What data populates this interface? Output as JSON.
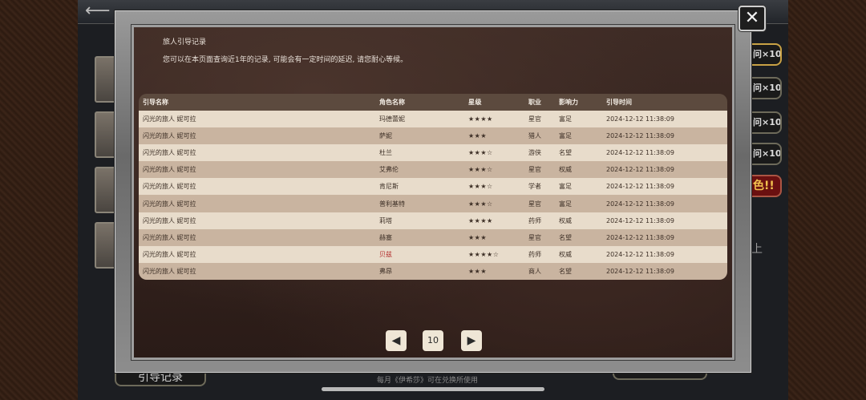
{
  "background": {
    "side_buttons": [
      "问×10",
      "问×10",
      "问×10",
      "问×10",
      "色!!"
    ],
    "side_text": "上",
    "bottom_button_label": "引导记录",
    "bottom_text": "每月《伊希莎》可在兑换所使用"
  },
  "modal": {
    "close_label": "✕",
    "title": "旅人引导记录",
    "subtitle": "您可以在本页面查询近1年的记录, 可能会有一定时间的延迟, 请您耐心等候。"
  },
  "table": {
    "headers": [
      "引导名称",
      "角色名称",
      "星级",
      "职业",
      "影响力",
      "引导时间"
    ],
    "rows": [
      [
        "闪光的旅人 妮可拉",
        "玛德蕾妮",
        "★★★★",
        "星官",
        "富足",
        "2024-12-12 11:38:09"
      ],
      [
        "闪光的旅人 妮可拉",
        "萨妮",
        "★★★",
        "猎人",
        "富足",
        "2024-12-12 11:38:09"
      ],
      [
        "闪光的旅人 妮可拉",
        "杜兰",
        "★★★☆",
        "游侠",
        "名望",
        "2024-12-12 11:38:09"
      ],
      [
        "闪光的旅人 妮可拉",
        "艾弗伦",
        "★★★☆",
        "星官",
        "权威",
        "2024-12-12 11:38:09"
      ],
      [
        "闪光的旅人 妮可拉",
        "肯尼斯",
        "★★★☆",
        "学者",
        "富足",
        "2024-12-12 11:38:09"
      ],
      [
        "闪光的旅人 妮可拉",
        "普利基特",
        "★★★☆",
        "星官",
        "富足",
        "2024-12-12 11:38:09"
      ],
      [
        "闪光的旅人 妮可拉",
        "莉塔",
        "★★★★",
        "药师",
        "权威",
        "2024-12-12 11:38:09"
      ],
      [
        "闪光的旅人 妮可拉",
        "赫塞",
        "★★★",
        "星官",
        "名望",
        "2024-12-12 11:38:09"
      ],
      [
        "闪光的旅人 妮可拉",
        "贝兹",
        "★★★★☆",
        "药师",
        "权威",
        "2024-12-12 11:38:09"
      ],
      [
        "闪光的旅人 妮可拉",
        "弗昂",
        "★★★",
        "商人",
        "名望",
        "2024-12-12 11:38:09"
      ]
    ],
    "highlight_row": 8,
    "highlight_color": "#b22a2a"
  },
  "pagination": {
    "prev_icon": "◀",
    "next_icon": "▶",
    "current_page": "10"
  }
}
